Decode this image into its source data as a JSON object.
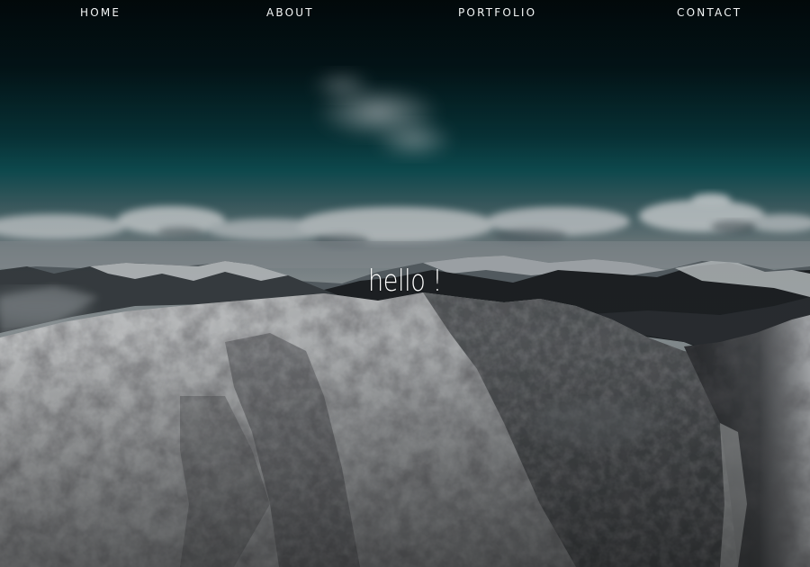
{
  "nav": {
    "items": [
      {
        "label": "HOME"
      },
      {
        "label": "ABOUT"
      },
      {
        "label": "PORTFOLIO"
      },
      {
        "label": "CONTACT"
      }
    ]
  },
  "hero": {
    "heading": "hello !",
    "background": "snowy-mountain-range-photo"
  },
  "colors": {
    "sky_top": "#020c0f",
    "sky_teal": "#0e4f54",
    "haze": "#6c7c82",
    "snow": "#c9ccce",
    "rock_shadow": "#2b2c2f"
  }
}
